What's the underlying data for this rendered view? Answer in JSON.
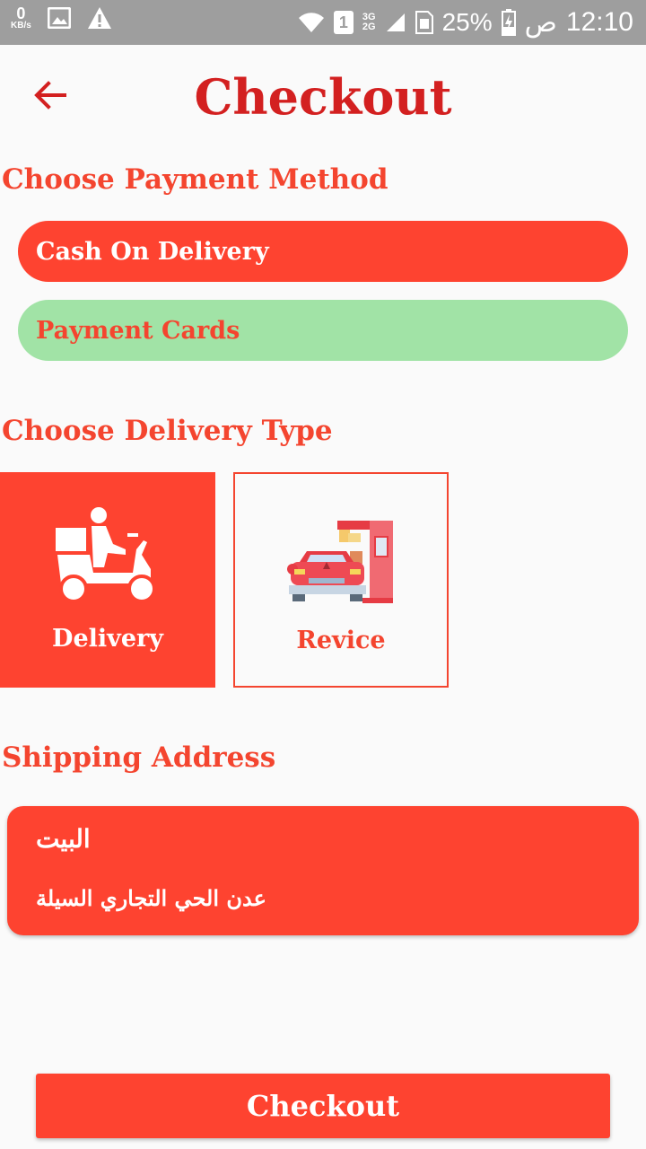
{
  "status_bar": {
    "speed_value": "0",
    "speed_unit": "KB/s",
    "sim_slot": "1",
    "network_top": "3G",
    "network_bottom": "2G",
    "battery": "25%",
    "ampm": "ص",
    "time": "12:10"
  },
  "header": {
    "title": "Checkout"
  },
  "payment": {
    "heading": "Choose Payment Method",
    "options": [
      "Cash On Delivery",
      "Payment Cards"
    ]
  },
  "delivery": {
    "heading": "Choose Delivery Type",
    "options": [
      "Delivery",
      "Revice"
    ]
  },
  "shipping": {
    "heading": "Shipping Address",
    "name": "البيت",
    "line": "عدن الحي التجاري السيلة"
  },
  "footer": {
    "checkout_label": "Checkout"
  },
  "colors": {
    "accent": "#fe4330",
    "title": "#d32020",
    "selected_card": "#a1e3a6"
  }
}
